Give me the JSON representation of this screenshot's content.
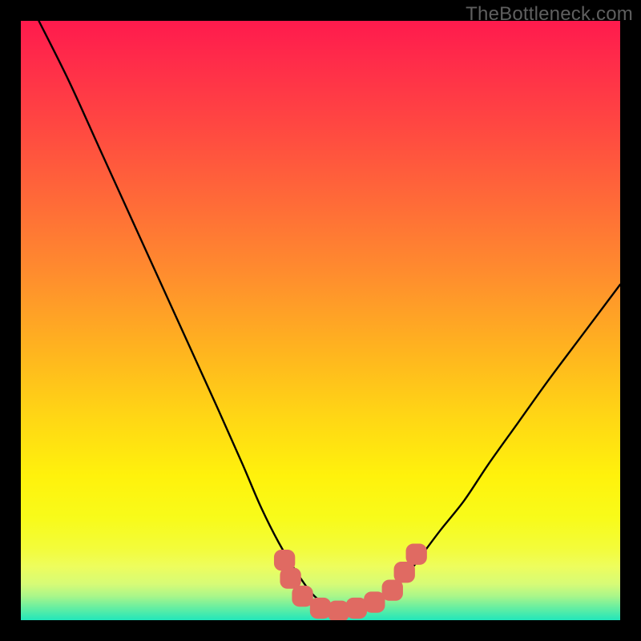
{
  "watermark": "TheBottleneck.com",
  "chart_data": {
    "type": "line",
    "title": "",
    "xlabel": "",
    "ylabel": "",
    "xlim": [
      0,
      100
    ],
    "ylim": [
      0,
      100
    ],
    "grid": false,
    "legend": false,
    "series": [
      {
        "name": "curve",
        "x": [
          3,
          8,
          13,
          18,
          23,
          28,
          33,
          37,
          40,
          43,
          46,
          49,
          52,
          55,
          58,
          61,
          64,
          67,
          70,
          74,
          78,
          83,
          88,
          94,
          100
        ],
        "y": [
          100,
          90,
          79,
          68,
          57,
          46,
          35,
          26,
          19,
          13,
          8,
          4,
          2,
          1.5,
          2,
          4,
          7,
          11,
          15,
          20,
          26,
          33,
          40,
          48,
          56
        ]
      }
    ],
    "markers": [
      {
        "pos": [
          44,
          10
        ],
        "r": 1.6
      },
      {
        "pos": [
          45,
          7
        ],
        "r": 1.6
      },
      {
        "pos": [
          47,
          4
        ],
        "r": 1.6
      },
      {
        "pos": [
          50,
          2
        ],
        "r": 1.6
      },
      {
        "pos": [
          53,
          1.5
        ],
        "r": 1.6
      },
      {
        "pos": [
          56,
          2
        ],
        "r": 1.6
      },
      {
        "pos": [
          59,
          3
        ],
        "r": 1.6
      },
      {
        "pos": [
          62,
          5
        ],
        "r": 1.6
      },
      {
        "pos": [
          64,
          8
        ],
        "r": 1.6
      },
      {
        "pos": [
          66,
          11
        ],
        "r": 1.6
      }
    ],
    "colors": {
      "curve": "#000000",
      "marker": "#e06a62",
      "gradient_top": "#ff1a4d",
      "gradient_bottom": "#22e6bb"
    }
  }
}
